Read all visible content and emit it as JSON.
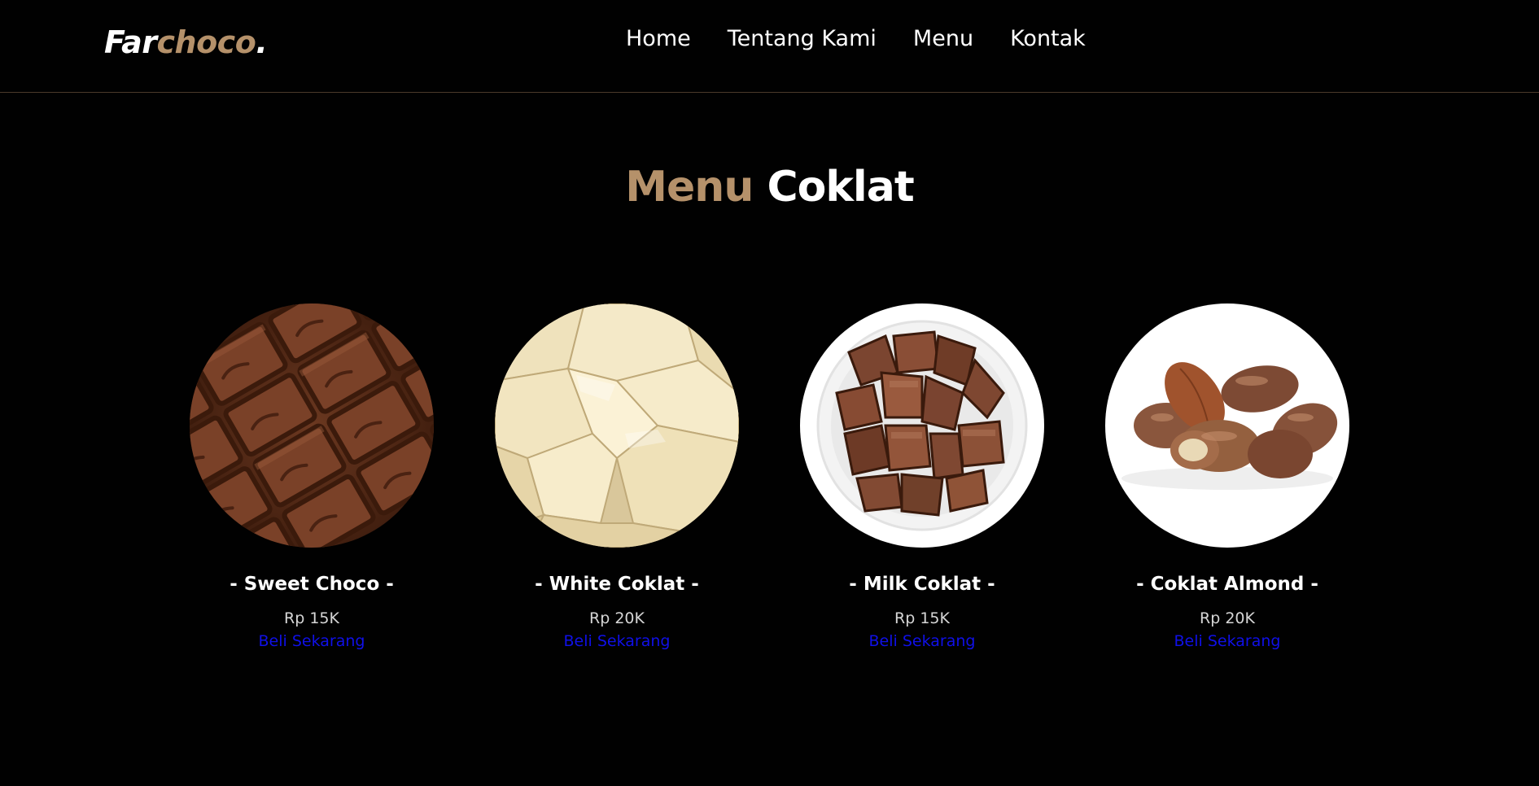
{
  "brand": {
    "part1": "Far",
    "part2": "choco",
    "part3": ".",
    "accent_color": "#b5916a"
  },
  "nav": {
    "items": [
      "Home",
      "Tentang Kami",
      "Menu",
      "Kontak"
    ]
  },
  "section": {
    "title_accent": "Menu",
    "title_rest": "Coklat"
  },
  "products": [
    {
      "title": "- Sweet Choco -",
      "price": "Rp 15K",
      "cta": "Beli Sekarang"
    },
    {
      "title": "- White Coklat -",
      "price": "Rp 20K",
      "cta": "Beli Sekarang"
    },
    {
      "title": "- Milk Coklat -",
      "price": "Rp 15K",
      "cta": "Beli Sekarang"
    },
    {
      "title": "- Coklat Almond -",
      "price": "Rp 20K",
      "cta": "Beli Sekarang"
    }
  ],
  "colors": {
    "background": "#010101",
    "link": "#1010e8",
    "text": "#ffffff"
  }
}
